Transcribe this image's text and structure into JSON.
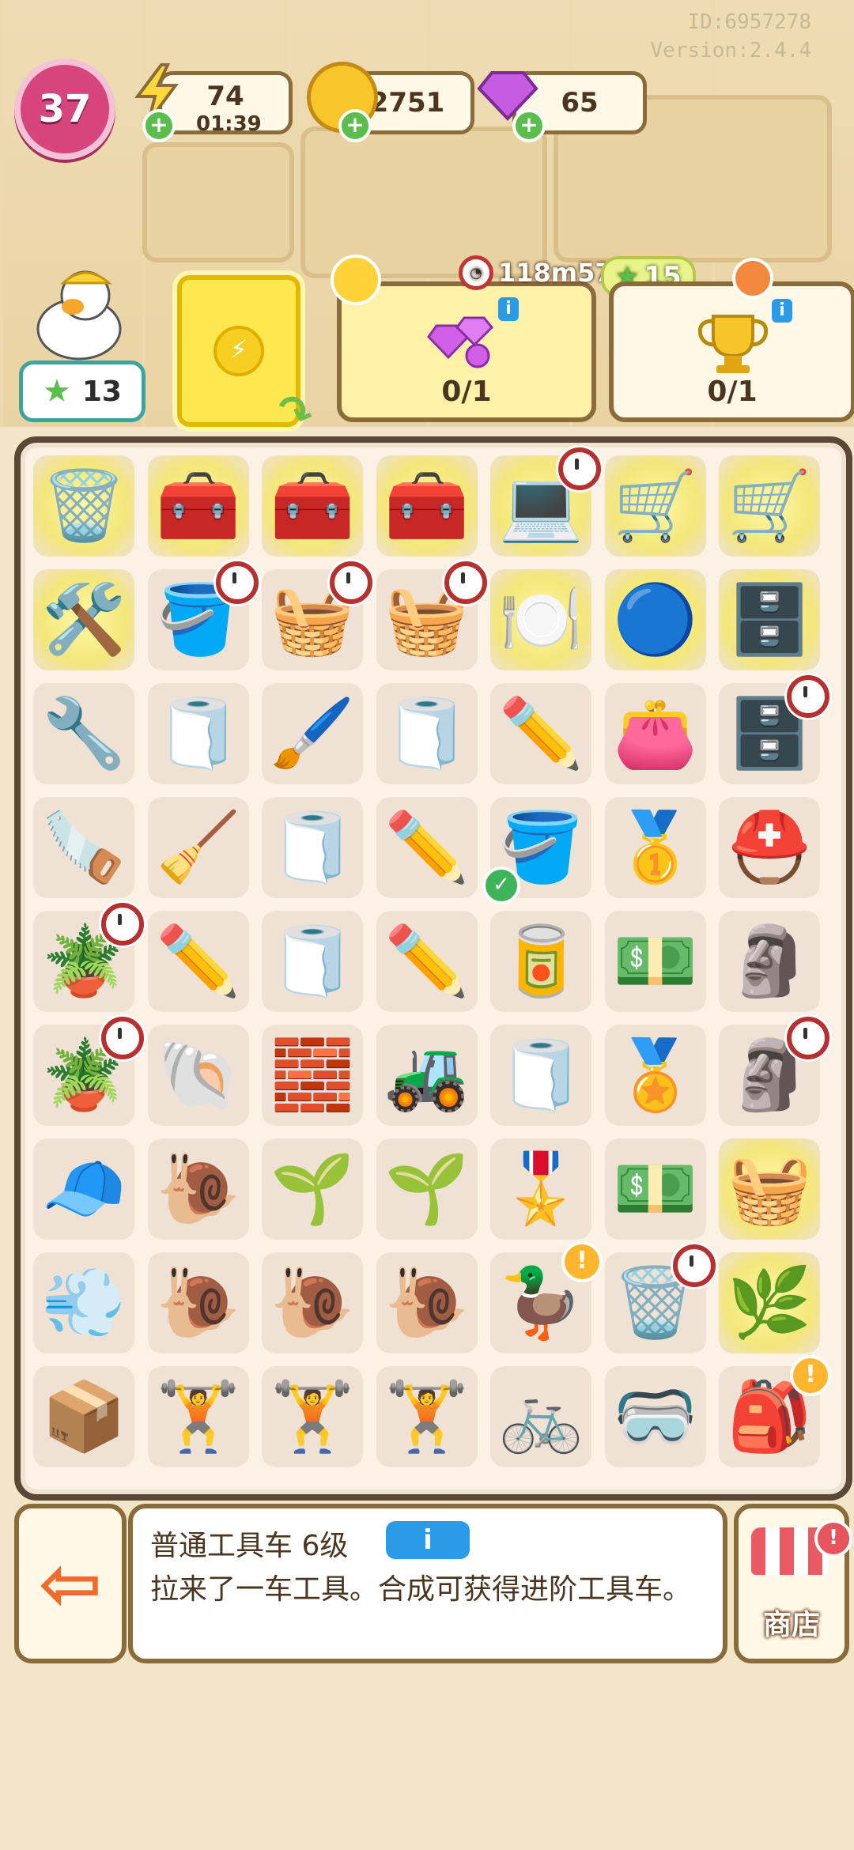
{
  "meta": {
    "id": "ID:6957278",
    "version": "Version:2.4.4"
  },
  "hud": {
    "level": "37",
    "energy": {
      "value": "74",
      "timer": "01:39"
    },
    "coins": "2751",
    "gems": "65",
    "stars": "13"
  },
  "tasks": {
    "timer": "118m57s",
    "reward": "15",
    "gem_task_progress": "0/1",
    "trophy_task_progress": "0/1"
  },
  "board": {
    "rows": [
      [
        {
          "icon": "garbage-bag",
          "emoji": "🗑️",
          "glow": true
        },
        {
          "icon": "green-toolbox",
          "emoji": "🧰",
          "glow": true
        },
        {
          "icon": "green-toolbox-stack",
          "emoji": "🧰",
          "glow": true
        },
        {
          "icon": "green-toolbox-stack",
          "emoji": "🧰",
          "glow": true
        },
        {
          "icon": "laptop",
          "emoji": "💻",
          "glow": true,
          "timer": true
        },
        {
          "icon": "tool-cart",
          "emoji": "🛒",
          "glow": true
        },
        {
          "icon": "duck-cart",
          "emoji": "🛒",
          "glow": true
        }
      ],
      [
        {
          "icon": "broken-wheelbarrow",
          "emoji": "🛠️",
          "glow": true
        },
        {
          "icon": "tool-bucket",
          "emoji": "🪣",
          "timer": true
        },
        {
          "icon": "tool-basket",
          "emoji": "🧺",
          "timer": true
        },
        {
          "icon": "tool-basket",
          "emoji": "🧺",
          "timer": true
        },
        {
          "icon": "blue-dish",
          "emoji": "🍽️",
          "glow": true
        },
        {
          "icon": "robot-vacuum",
          "emoji": "🔵",
          "glow": true
        },
        {
          "icon": "wooden-cabinet",
          "emoji": "🗄️",
          "glow": true
        }
      ],
      [
        {
          "icon": "pliers",
          "emoji": "🔧"
        },
        {
          "icon": "tape-roll",
          "emoji": "🧻"
        },
        {
          "icon": "paint-roller",
          "emoji": "🖌️"
        },
        {
          "icon": "tape-roll",
          "emoji": "🧻"
        },
        {
          "icon": "pencil",
          "emoji": "✏️"
        },
        {
          "icon": "wallet",
          "emoji": "👛"
        },
        {
          "icon": "drawer-set",
          "emoji": "🗄️",
          "timer": true
        }
      ],
      [
        {
          "icon": "hacksaw",
          "emoji": "🪚"
        },
        {
          "icon": "trowel",
          "emoji": "🧹"
        },
        {
          "icon": "tape-roll",
          "emoji": "🧻"
        },
        {
          "icon": "pencil",
          "emoji": "✏️"
        },
        {
          "icon": "paint-bucket",
          "emoji": "🪣",
          "check": true
        },
        {
          "icon": "gold-medal",
          "emoji": "🥇"
        },
        {
          "icon": "helmet",
          "emoji": "⛑️"
        }
      ],
      [
        {
          "icon": "potted-tree",
          "emoji": "🪴",
          "timer": true
        },
        {
          "icon": "pencil",
          "emoji": "✏️"
        },
        {
          "icon": "tape-roll",
          "emoji": "🧻"
        },
        {
          "icon": "pencil",
          "emoji": "✏️"
        },
        {
          "icon": "paint-can",
          "emoji": "🥫"
        },
        {
          "icon": "cash-stack",
          "emoji": "💵"
        },
        {
          "icon": "stone-statue",
          "emoji": "🗿"
        }
      ],
      [
        {
          "icon": "potted-tree",
          "emoji": "🪴",
          "timer": true
        },
        {
          "icon": "snail-shell",
          "emoji": "🐚"
        },
        {
          "icon": "pink-brick",
          "emoji": "🧱"
        },
        {
          "icon": "toy-tank",
          "emoji": "🚜"
        },
        {
          "icon": "tape-roll",
          "emoji": "🧻"
        },
        {
          "icon": "gold-medal",
          "emoji": "🏅"
        },
        {
          "icon": "stone-statue",
          "emoji": "🗿",
          "timer": true
        }
      ],
      [
        {
          "icon": "blue-hat",
          "emoji": "🧢"
        },
        {
          "icon": "snail",
          "emoji": "🐌"
        },
        {
          "icon": "seed-packet",
          "emoji": "🌱"
        },
        {
          "icon": "seed-bag",
          "emoji": "🌱"
        },
        {
          "icon": "award-badge",
          "emoji": "🎖️"
        },
        {
          "icon": "cash-pile",
          "emoji": "💵"
        },
        {
          "icon": "wicker-basket",
          "emoji": "🧺",
          "glow": true
        }
      ],
      [
        {
          "icon": "hair-dryer",
          "emoji": "💨"
        },
        {
          "icon": "cat-snail",
          "emoji": "🐌"
        },
        {
          "icon": "cat-snail",
          "emoji": "🐌"
        },
        {
          "icon": "cat-snail-red",
          "emoji": "🐌"
        },
        {
          "icon": "duck-float",
          "emoji": "🦆",
          "alert": true
        },
        {
          "icon": "trash-bin",
          "emoji": "🗑️",
          "timer": true
        },
        {
          "icon": "plant-pot",
          "emoji": "🌿",
          "glow": true
        }
      ],
      [
        {
          "icon": "purple-crate",
          "emoji": "📦"
        },
        {
          "icon": "barbell-bench",
          "emoji": "🏋️"
        },
        {
          "icon": "kettlebell",
          "emoji": "🏋️"
        },
        {
          "icon": "dumbbells",
          "emoji": "🏋️"
        },
        {
          "icon": "exercise-bike",
          "emoji": "🚲"
        },
        {
          "icon": "vr-headset",
          "emoji": "🥽"
        },
        {
          "icon": "pink-backpack",
          "emoji": "🎒",
          "alert": true
        }
      ]
    ]
  },
  "selected_item": {
    "title": "普通工具车 6级",
    "info_label": "i",
    "description": "拉来了一车工具。合成可获得进阶工具车。"
  },
  "buttons": {
    "exit_icon": "⇦",
    "shop_label": "商店"
  },
  "colors": {
    "accent": "#d8457e",
    "board_border": "#5b4735",
    "info_blue": "#2c9be7",
    "star_green": "#5bbd4c"
  }
}
